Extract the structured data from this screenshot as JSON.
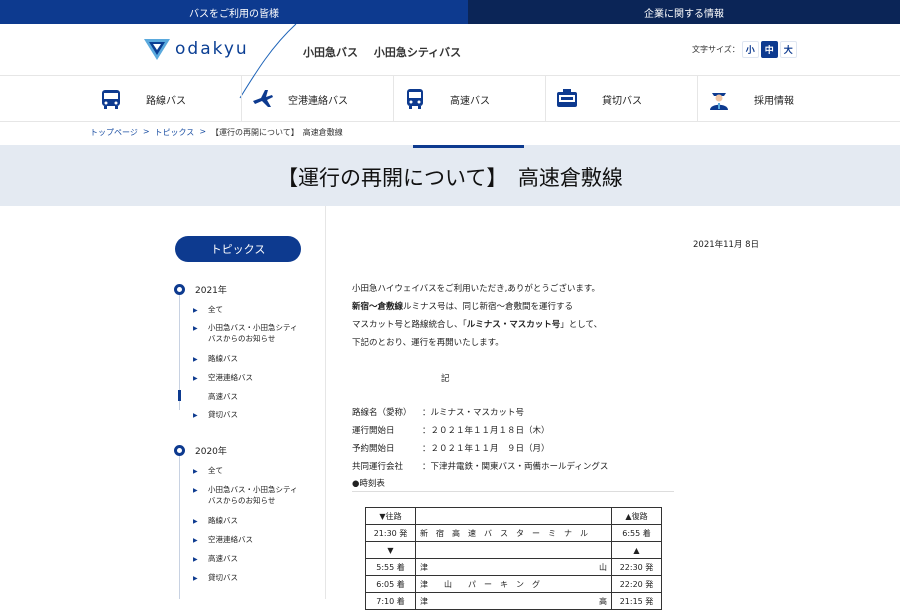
{
  "topbar": {
    "active_tab": "バスをご利用の皆様",
    "other_tab": "企業に関する情報"
  },
  "header": {
    "logo_text": "odakyu",
    "brand1": "小田急バス",
    "brand2": "小田急シティバス",
    "fontsize_label": "文字サイズ：",
    "fontsize_small": "小",
    "fontsize_medium": "中",
    "fontsize_large": "大"
  },
  "gnav": [
    {
      "label": "路線バス",
      "icon": "bus-icon"
    },
    {
      "label": "空港連絡バス",
      "icon": "airplane-icon"
    },
    {
      "label": "高速バス",
      "icon": "express-bus-icon"
    },
    {
      "label": "貸切バス",
      "icon": "charter-bus-icon"
    },
    {
      "label": "採用情報",
      "icon": "recruit-staff-icon"
    }
  ],
  "breadcrumb": {
    "home": "トップページ",
    "sep": ">",
    "topics": "トピックス",
    "current": "【運行の再開について】　高速倉敷線"
  },
  "page_title": "【運行の再開について】　高速倉敷線",
  "sidebar": {
    "topics_button": "トピックス",
    "years": [
      {
        "year": "2021年",
        "items": [
          "全て",
          "小田急バス・小田急シティ",
          "バスからのお知らせ",
          "路線バス",
          "空港連絡バス",
          "高速バス",
          "貸切バス"
        ]
      },
      {
        "year": "2020年",
        "items": [
          "全て",
          "小田急バス・小田急シティ",
          "バスからのお知らせ",
          "路線バス",
          "空港連絡バス",
          "高速バス",
          "貸切バス"
        ]
      }
    ]
  },
  "article": {
    "date": "2021年11月 8日",
    "line1": "小田急ハイウェイバスをご利用いただき,ありがとうございます。",
    "line2_bold": "新宿～倉敷線",
    "line2_rest": "ルミナス号は、同じ新宿～倉敷間を運行する",
    "line3_pre": "マスカット号と路線統合し、「",
    "line3_bold": "ルミナス・マスカット号",
    "line3_post": "」として、",
    "line4": "下記のとおり、運行を再開いたします。",
    "ki": "記",
    "details": [
      {
        "k": "路線名（愛称）",
        "v": "：ルミナス・マスカット号"
      },
      {
        "k": "運行開始日",
        "v": "：２０２１年１１月１８日（木）"
      },
      {
        "k": "予約開始日",
        "v": "：２０２１年１１月　９日（月）"
      },
      {
        "k": "共同運行会社",
        "v": "：下津井電鉄・関東バス・両備ホールディングス"
      }
    ],
    "timetable_label": "●時刻表"
  },
  "timetable": {
    "outbound": "▼往路",
    "return": "▲復路",
    "arrow_down": "▼",
    "arrow_up": "▲",
    "rows": [
      {
        "out": "21:30 発",
        "stop_left": "新　宿　高　速　バ　ス　タ　ー　ミ　ナ　ル",
        "stop_right": "",
        "ret": "6:55 着"
      },
      {
        "out": "5:55 着",
        "stop_left": "津",
        "stop_right": "山",
        "ret": "22:30 発"
      },
      {
        "out": "6:05 着",
        "stop_left": "津　　山　　パ　ー　キ　ン　グ",
        "stop_right": "",
        "ret": "22:20 発"
      },
      {
        "out": "7:10 着",
        "stop_left": "津",
        "stop_right": "高",
        "ret": "21:15 発"
      }
    ]
  }
}
